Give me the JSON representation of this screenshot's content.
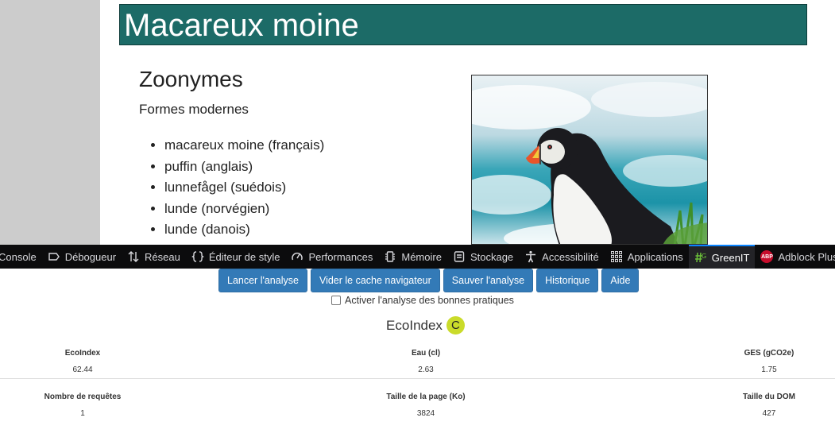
{
  "page": {
    "title": "Macareux moine",
    "heading": "Zoonymes",
    "subheading": "Formes modernes",
    "names": [
      "macareux moine (français)",
      "puffin (anglais)",
      "lunnefågel (suédois)",
      "lunde (norvégien)",
      "lunde (danois)"
    ]
  },
  "devtools": {
    "tabs": [
      {
        "label": "Console",
        "icon": "console-icon"
      },
      {
        "label": "Débogueur",
        "icon": "debugger-icon"
      },
      {
        "label": "Réseau",
        "icon": "network-icon"
      },
      {
        "label": "Éditeur de style",
        "icon": "style-editor-icon"
      },
      {
        "label": "Performances",
        "icon": "performance-icon"
      },
      {
        "label": "Mémoire",
        "icon": "memory-icon"
      },
      {
        "label": "Stockage",
        "icon": "storage-icon"
      },
      {
        "label": "Accessibilité",
        "icon": "accessibility-icon"
      },
      {
        "label": "Applications",
        "icon": "applications-icon"
      },
      {
        "label": "GreenIT",
        "icon": "greenit-icon",
        "active": true
      },
      {
        "label": "Adblock Plus",
        "icon": "adblock-plus-icon",
        "badge": "ABP"
      }
    ]
  },
  "greenit": {
    "buttons": [
      "Lancer l'analyse",
      "Vider le cache navigateur",
      "Sauver l'analyse",
      "Historique",
      "Aide"
    ],
    "checkbox_label": "Activer l'analyse des bonnes pratiques",
    "ecoindex_title": "EcoIndex",
    "grade": "C",
    "metrics": [
      {
        "label": "EcoIndex",
        "value": "62.44"
      },
      {
        "label": "Eau (cl)",
        "value": "2.63"
      },
      {
        "label": "GES (gCO2e)",
        "value": "1.75"
      },
      {
        "label": "Nombre de requêtes",
        "value": "1"
      },
      {
        "label": "Taille de la page (Ko)",
        "value": "3824"
      },
      {
        "label": "Taille du DOM",
        "value": "427"
      }
    ]
  },
  "colors": {
    "title_bar": "#1c6b67",
    "devtools_bg": "#0c0c0d",
    "active_tab_accent": "#0a84ff",
    "button": "#337ab7",
    "grade_badge": "#cadb2a",
    "abp_badge": "#c70d2c"
  }
}
